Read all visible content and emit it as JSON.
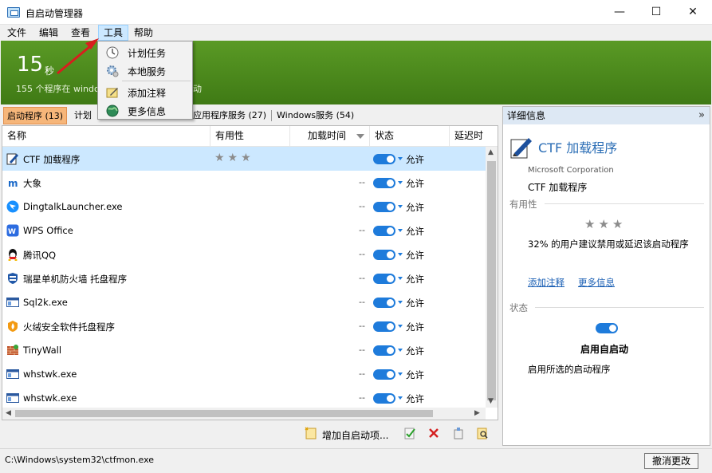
{
  "window": {
    "title": "自启动管理器",
    "minimize": "—",
    "maximize": "☐",
    "close": "✕"
  },
  "menu": [
    "文件",
    "编辑",
    "查看",
    "工具",
    "帮助"
  ],
  "tools_menu": [
    {
      "label": "计划任务",
      "icon": "clock-icon"
    },
    {
      "label": "本地服务",
      "icon": "gear-icon"
    },
    {
      "label": "添加注释",
      "icon": "note-icon"
    },
    {
      "label": "更多信息",
      "icon": "globe-icon"
    }
  ],
  "banner": {
    "seconds": "15",
    "unit": "秒",
    "subtitle": "155 个程序在 windo",
    "subtitle_tail": "动"
  },
  "tabs": [
    "启动程序 (13)",
    "计划",
    "应用程序服务 (27)",
    "Windows服务 (54)"
  ],
  "columns": [
    "名称",
    "有用性",
    "加载时间",
    "状态",
    "延迟时"
  ],
  "rows": [
    {
      "name": "CTF 加载程序",
      "stars": "★★★",
      "load": "",
      "status": "允许",
      "icon": "pen-icon",
      "selected": true
    },
    {
      "name": "大象",
      "stars": "",
      "load": "--",
      "status": "允许",
      "icon": "elephant-icon"
    },
    {
      "name": "DingtalkLauncher.exe",
      "stars": "",
      "load": "--",
      "status": "允许",
      "icon": "dingtalk-icon"
    },
    {
      "name": "WPS Office",
      "stars": "",
      "load": "--",
      "status": "允许",
      "icon": "wps-icon"
    },
    {
      "name": "腾讯QQ",
      "stars": "",
      "load": "--",
      "status": "允许",
      "icon": "qq-icon"
    },
    {
      "name": "瑞星单机防火墙 托盘程序",
      "stars": "",
      "load": "--",
      "status": "允许",
      "icon": "shield-icon"
    },
    {
      "name": "Sql2k.exe",
      "stars": "",
      "load": "--",
      "status": "允许",
      "icon": "window-icon"
    },
    {
      "name": "火绒安全软件托盘程序",
      "stars": "",
      "load": "--",
      "status": "允许",
      "icon": "huorong-icon"
    },
    {
      "name": "TinyWall",
      "stars": "",
      "load": "--",
      "status": "允许",
      "icon": "wall-icon"
    },
    {
      "name": "whstwk.exe",
      "stars": "",
      "load": "--",
      "status": "允许",
      "icon": "window-icon"
    },
    {
      "name": "whstwk.exe",
      "stars": "",
      "load": "--",
      "status": "允许",
      "icon": "window-icon"
    }
  ],
  "toolbar": {
    "add_label": "增加自启动项..."
  },
  "detail": {
    "header": "详细信息",
    "collapse": "»",
    "title": "CTF 加载程序",
    "publisher": "Microsoft Corporation",
    "name": "CTF 加载程序",
    "usefulness_label": "有用性",
    "stars": "★★★",
    "usefulness_desc": "32% 的用户建议禁用或延迟该启动程序",
    "link_add_note": "添加注释",
    "link_more_info": "更多信息",
    "status_label": "状态",
    "toggle_label": "启用自启动",
    "toggle_desc": "启用所选的启动程序"
  },
  "status": {
    "path": "C:\\Windows\\system32\\ctfmon.exe",
    "undo": "撤消更改"
  },
  "colors": {
    "banner_green": "#4a8a1c",
    "accent_blue": "#1e7bdb",
    "active_tab": "#f6b67a",
    "selection": "#cce8ff"
  }
}
